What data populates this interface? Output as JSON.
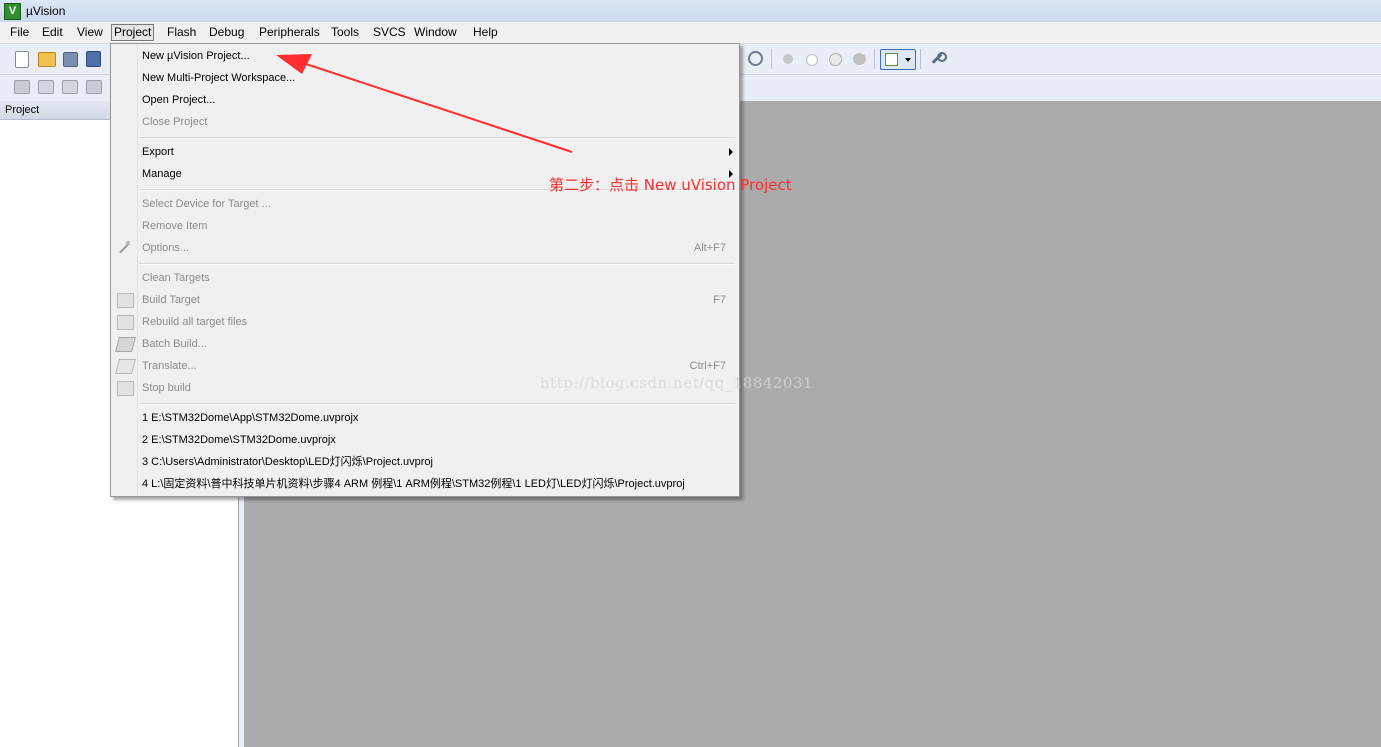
{
  "window": {
    "title": "µVision",
    "icon": "uvision-logo-icon"
  },
  "menubar": {
    "items": [
      "File",
      "Edit",
      "View",
      "Project",
      "Flash",
      "Debug",
      "Peripherals",
      "Tools",
      "SVCS",
      "Window",
      "Help"
    ],
    "active": "Project"
  },
  "project_panel": {
    "title": "Project"
  },
  "project_menu": {
    "new_project": "New µVision Project...",
    "new_workspace": "New Multi-Project Workspace...",
    "open_project": "Open Project...",
    "close_project": "Close Project",
    "export": "Export",
    "manage": "Manage",
    "select_device": "Select Device for Target ...",
    "remove_item": "Remove Item",
    "options": "Options...",
    "options_shortcut": "Alt+F7",
    "clean_targets": "Clean Targets",
    "build_target": "Build Target",
    "build_target_shortcut": "F7",
    "rebuild_all": "Rebuild all target files",
    "batch_build": "Batch Build...",
    "translate": "Translate...",
    "translate_shortcut": "Ctrl+F7",
    "stop_build": "Stop build",
    "recent": [
      "1 E:\\STM32Dome\\App\\STM32Dome.uvprojx",
      "2 E:\\STM32Dome\\STM32Dome.uvprojx",
      "3 C:\\Users\\Administrator\\Desktop\\LED灯闪烁\\Project.uvproj",
      "4 L:\\固定资料\\普中科技单片机资料\\步骤4 ARM 例程\\1 ARM例程\\STM32例程\\1 LED灯\\LED灯闪烁\\Project.uvproj"
    ]
  },
  "annotation": {
    "text": "第二步：点击 New uVision Project",
    "color": "#ff2d2d"
  },
  "watermark": {
    "text": "http://blog.csdn.net/qq_18842031"
  }
}
